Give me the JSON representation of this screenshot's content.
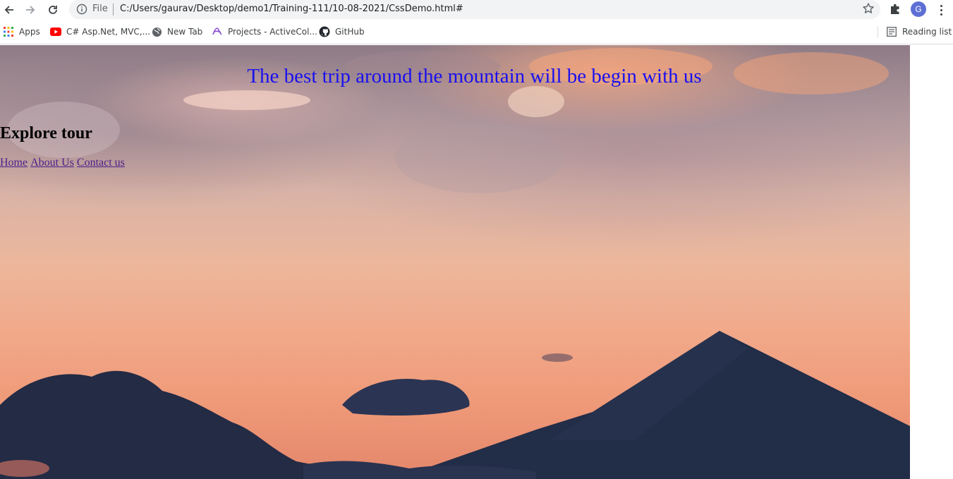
{
  "browser": {
    "file_label": "File",
    "url": "C:/Users/gaurav/Desktop/demo1/Training-111/10-08-2021/CssDemo.html#",
    "profile_initial": "G",
    "bookmarks": [
      {
        "label": "Apps",
        "icon": "apps-grid-icon"
      },
      {
        "label": "C# Asp.Net, MVC,...",
        "icon": "youtube-icon"
      },
      {
        "label": "New Tab",
        "icon": "globe-icon"
      },
      {
        "label": "Projects - ActiveCol...",
        "icon": "activecollab-icon"
      },
      {
        "label": "GitHub",
        "icon": "github-icon"
      }
    ],
    "reading_list": "Reading list"
  },
  "page": {
    "headline": "The best trip around the mountain will be begin with us",
    "brand": "Explore tour",
    "nav": [
      "Home",
      "About Us",
      "Contact us"
    ]
  },
  "colors": {
    "headline": "#1a10ee",
    "link": "#4b1f8a",
    "mountain": "#1f2a44",
    "sky_top": "#8e7b86",
    "sky_bottom": "#e4866b"
  }
}
